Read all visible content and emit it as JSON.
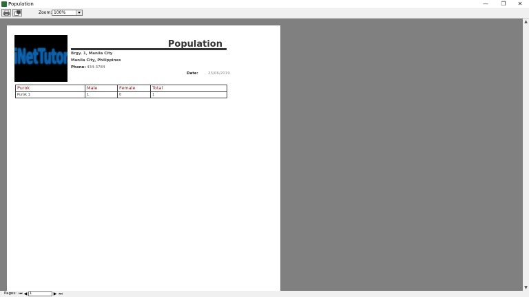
{
  "window": {
    "title": "Population",
    "min_glyph": "—",
    "max_glyph": "❐",
    "close_glyph": "✕"
  },
  "toolbar": {
    "print_icon": "printer-icon",
    "export_icon": "export-icon",
    "zoom_label": "Zoom:",
    "zoom_value": "100%"
  },
  "report": {
    "logo_text": "iNetTutor.com",
    "title": "Population",
    "address_line1": "Brgy. 1, Manila City",
    "address_line2": "Manila City, Philippines",
    "phone_label": "Phone:",
    "phone_value": "434-3784",
    "date_label": "Date:",
    "date_value": "23/06/2019",
    "columns": [
      "Purok",
      "Male",
      "Female",
      "Total"
    ],
    "rows": [
      [
        "Purok 1",
        "1",
        "0",
        "1"
      ]
    ]
  },
  "status": {
    "pages_label": "Pages:",
    "page_value": "1",
    "first_glyph": "⏮",
    "prev_glyph": "◀",
    "next_glyph": "▶",
    "last_glyph": "⏭"
  },
  "colors": {
    "column_header": "#8b1010",
    "viewer_background": "#808080",
    "logo_text": "#0d5fa8"
  }
}
